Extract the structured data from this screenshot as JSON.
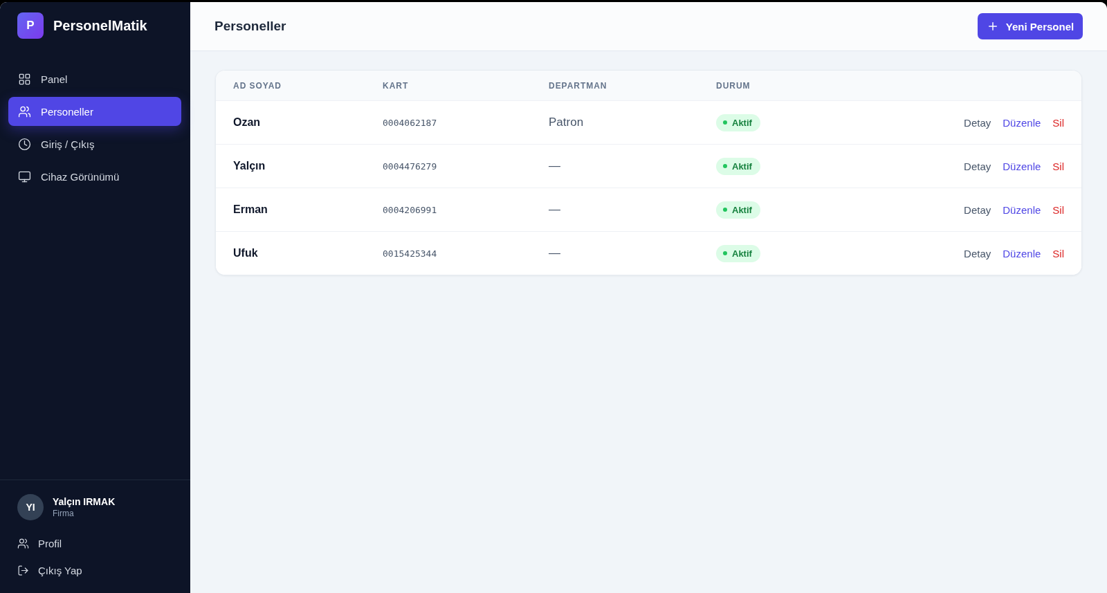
{
  "brand": {
    "logo_letter": "P",
    "name": "PersonelMatik"
  },
  "sidebar": {
    "items": [
      {
        "label": "Panel",
        "selected": false
      },
      {
        "label": "Personeller",
        "selected": true
      },
      {
        "label": "Giriş / Çıkış",
        "selected": false
      },
      {
        "label": "Cihaz Görünümü",
        "selected": false
      }
    ]
  },
  "user": {
    "initials": "YI",
    "name": "Yalçın IRMAK",
    "role": "Firma"
  },
  "footer_links": [
    {
      "label": "Profil"
    },
    {
      "label": "Çıkış Yap"
    }
  ],
  "header": {
    "title": "Personeller",
    "primary_button": "Yeni Personel"
  },
  "table": {
    "columns": [
      "AD SOYAD",
      "KART",
      "DEPARTMAN",
      "DURUM"
    ],
    "rows": [
      {
        "name": "Ozan",
        "card": "0004062187",
        "department": "Patron",
        "status": {
          "label": "Aktif",
          "kind": "active"
        },
        "actions": [
          {
            "label": "Detay",
            "kind": "neutral"
          },
          {
            "label": "Düzenle",
            "kind": "primary"
          },
          {
            "label": "Sil",
            "kind": "danger"
          }
        ]
      },
      {
        "name": "Yalçın",
        "card": "0004476279",
        "department": "—",
        "status": {
          "label": "Aktif",
          "kind": "active"
        },
        "actions": [
          {
            "label": "Detay",
            "kind": "neutral"
          },
          {
            "label": "Düzenle",
            "kind": "primary"
          },
          {
            "label": "Sil",
            "kind": "danger"
          }
        ]
      },
      {
        "name": "Erman",
        "card": "0004206991",
        "department": "—",
        "status": {
          "label": "Aktif",
          "kind": "active"
        },
        "actions": [
          {
            "label": "Detay",
            "kind": "neutral"
          },
          {
            "label": "Düzenle",
            "kind": "primary"
          },
          {
            "label": "Sil",
            "kind": "danger"
          }
        ]
      },
      {
        "name": "Ufuk",
        "card": "0015425344",
        "department": "—",
        "status": {
          "label": "Aktif",
          "kind": "active"
        },
        "actions": [
          {
            "label": "Detay",
            "kind": "neutral"
          },
          {
            "label": "Düzenle",
            "kind": "primary"
          },
          {
            "label": "Sil",
            "kind": "danger"
          }
        ]
      }
    ]
  }
}
